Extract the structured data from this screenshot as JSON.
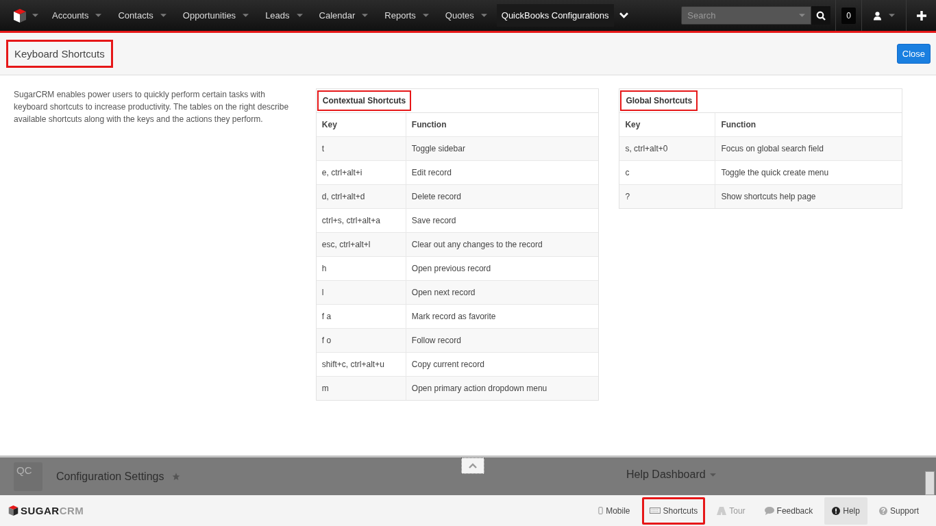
{
  "nav": {
    "items": [
      {
        "label": "Accounts",
        "selected": false
      },
      {
        "label": "Contacts",
        "selected": false
      },
      {
        "label": "Opportunities",
        "selected": false
      },
      {
        "label": "Leads",
        "selected": false
      },
      {
        "label": "Calendar",
        "selected": false
      },
      {
        "label": "Reports",
        "selected": false
      },
      {
        "label": "Quotes",
        "selected": false
      },
      {
        "label": "QuickBooks Configurations",
        "selected": true
      }
    ],
    "search": {
      "placeholder": "Search"
    },
    "notifications": "0"
  },
  "header": {
    "title": "Keyboard Shortcuts",
    "highlighted": true,
    "close": "Close"
  },
  "intro": "SugarCRM enables power users to quickly perform certain tasks with keyboard shortcuts to increase productivity. The tables on the right describe available shortcuts along with the keys and the actions they perform.",
  "tables": [
    {
      "title": "Contextual Shortcuts",
      "highlighted": true,
      "columns": [
        "Key",
        "Function"
      ],
      "rows": [
        [
          "t",
          "Toggle sidebar"
        ],
        [
          "e, ctrl+alt+i",
          "Edit record"
        ],
        [
          "d, ctrl+alt+d",
          "Delete record"
        ],
        [
          "ctrl+s, ctrl+alt+a",
          "Save record"
        ],
        [
          "esc, ctrl+alt+l",
          "Clear out any changes to the record"
        ],
        [
          "h",
          "Open previous record"
        ],
        [
          "l",
          "Open next record"
        ],
        [
          "f a",
          "Mark record as favorite"
        ],
        [
          "f o",
          "Follow record"
        ],
        [
          "shift+c, ctrl+alt+u",
          "Copy current record"
        ],
        [
          "m",
          "Open primary action dropdown menu"
        ]
      ]
    },
    {
      "title": "Global Shortcuts",
      "highlighted": true,
      "columns": [
        "Key",
        "Function"
      ],
      "rows": [
        [
          "s, ctrl+alt+0",
          "Focus on global search field"
        ],
        [
          "c",
          "Toggle the quick create menu"
        ],
        [
          "?",
          "Show shortcuts help page"
        ]
      ]
    }
  ],
  "dashlet": {
    "tile": "QC",
    "title": "Configuration Settings",
    "help": "Help Dashboard"
  },
  "footer": {
    "logo": {
      "strong": "SUGAR",
      "light": "CRM"
    },
    "items": [
      {
        "kind": "mobile",
        "label": "Mobile",
        "highlighted": false,
        "disabled": false,
        "selected": false
      },
      {
        "kind": "shortcuts",
        "label": "Shortcuts",
        "highlighted": true,
        "disabled": false,
        "selected": false
      },
      {
        "kind": "tour",
        "label": "Tour",
        "highlighted": false,
        "disabled": true,
        "selected": false
      },
      {
        "kind": "feedback",
        "label": "Feedback",
        "highlighted": false,
        "disabled": false,
        "selected": false
      },
      {
        "kind": "help",
        "label": "Help",
        "highlighted": false,
        "disabled": false,
        "selected": true
      },
      {
        "kind": "support",
        "label": "Support",
        "highlighted": false,
        "disabled": false,
        "selected": false
      }
    ]
  }
}
